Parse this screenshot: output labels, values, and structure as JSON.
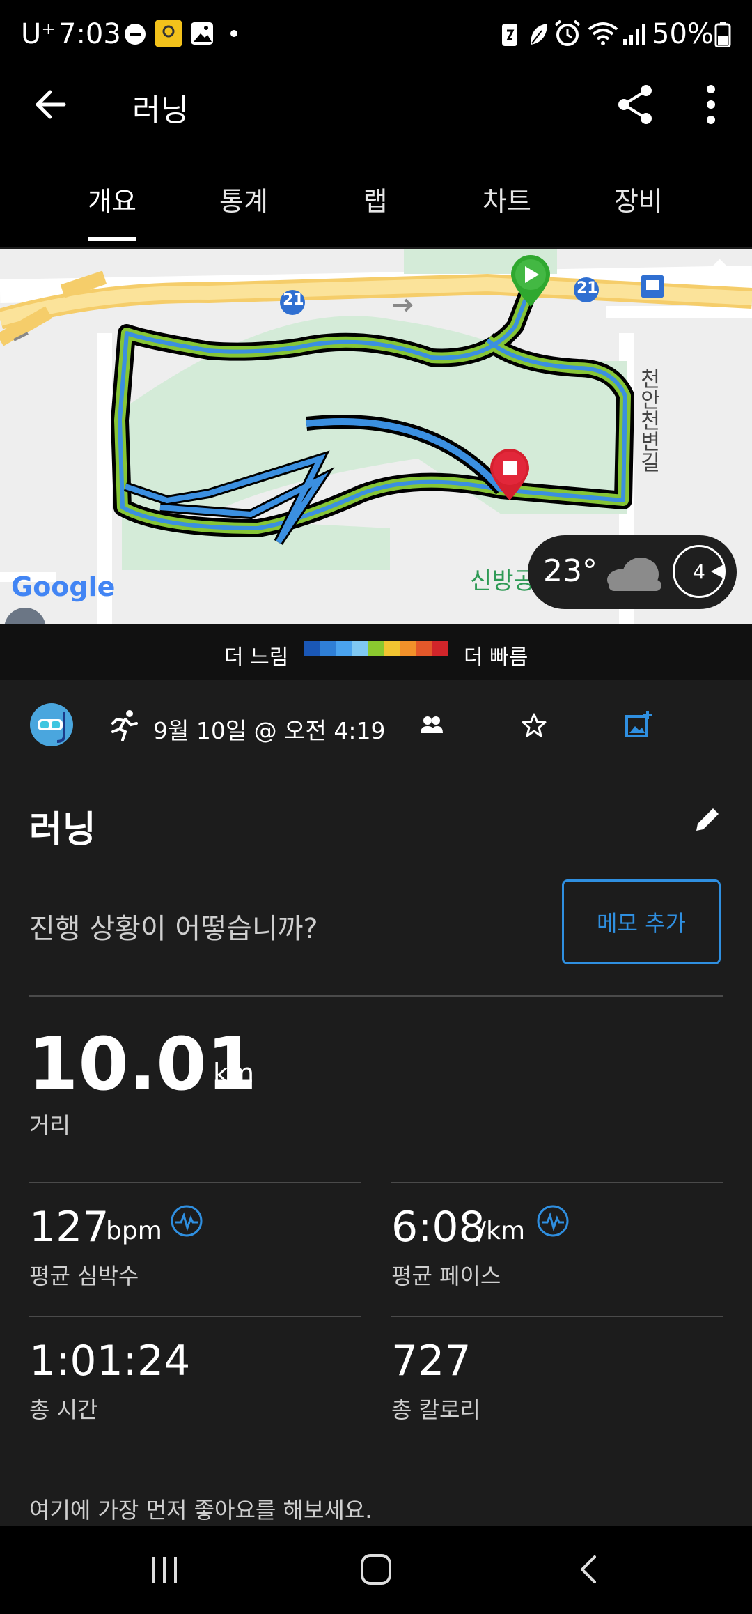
{
  "status_bar": {
    "carrier": "U⁺",
    "time": "7:03",
    "battery": "50%"
  },
  "header": {
    "title": "러닝"
  },
  "tabs": [
    {
      "label": "개요",
      "active": true
    },
    {
      "label": "통계",
      "active": false
    },
    {
      "label": "랩",
      "active": false
    },
    {
      "label": "차트",
      "active": false
    },
    {
      "label": "장비",
      "active": false
    }
  ],
  "map": {
    "road_number": "21",
    "road_number_2": "21",
    "street_label": "천안천변길",
    "park_label": "신방공",
    "google_logo": "Google",
    "weather": {
      "temperature": "23°",
      "wind": "4"
    }
  },
  "pace_legend": {
    "slow_label": "더 느림",
    "fast_label": "더 빠름",
    "colors": [
      "#1a57b6",
      "#2f7fd6",
      "#4aa3ee",
      "#7fc8f2",
      "#8bc92f",
      "#f2c531",
      "#f2912a",
      "#e3582a",
      "#d1252a"
    ]
  },
  "activity_meta": {
    "date": "9월 10일 @ 오전 4:19"
  },
  "activity": {
    "title": "러닝",
    "question": "진행 상황이 어떻습니까?",
    "memo_button": "메모 추가"
  },
  "stats": {
    "distance": {
      "value": "10.01",
      "unit": "km",
      "label": "거리"
    },
    "avg_hr": {
      "value": "127",
      "unit": "bpm",
      "label": "평균 심박수"
    },
    "avg_pace": {
      "value": "6:08",
      "unit": "/km",
      "label": "평균 페이스"
    },
    "total_time": {
      "value": "1:01:24",
      "label": "총 시간"
    },
    "calories": {
      "value": "727",
      "label": "총 칼로리"
    }
  },
  "likes_text": "여기에 가장 먼저 좋아요를 해보세요.",
  "accent_color": "#2f8fe0"
}
